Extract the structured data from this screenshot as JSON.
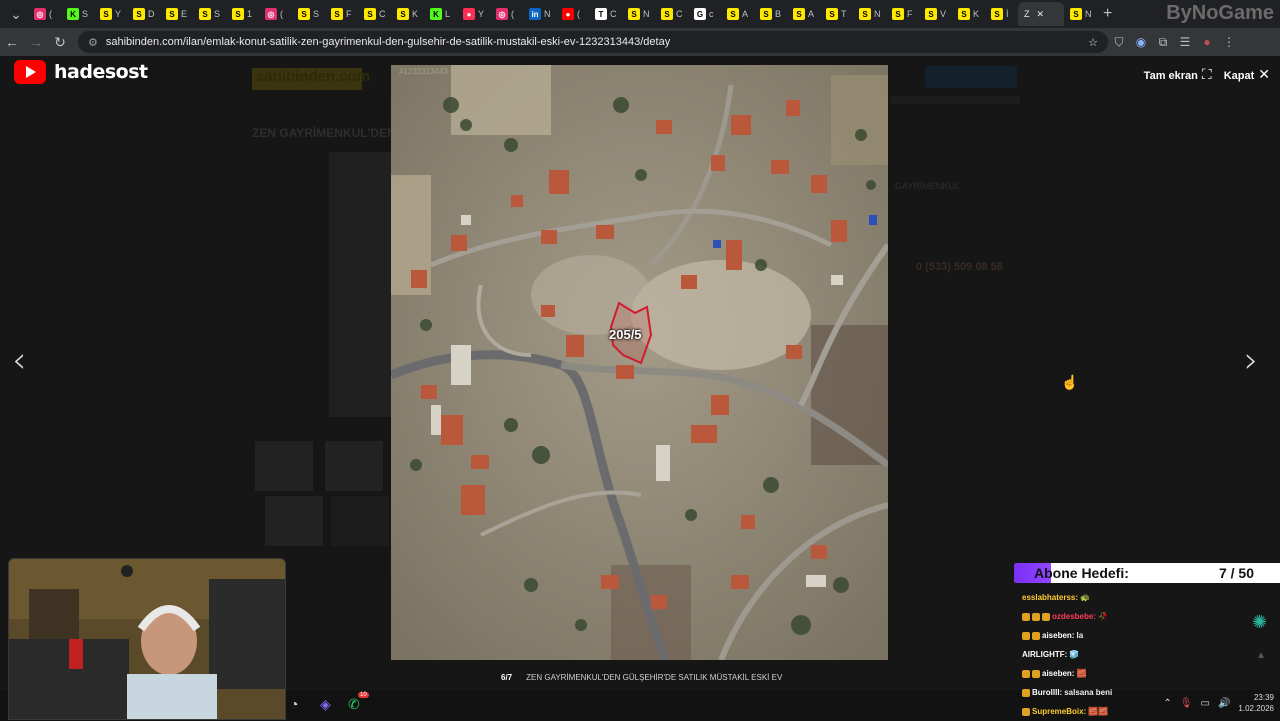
{
  "browser": {
    "tabs": [
      {
        "glyph": "◎",
        "color": "#e1306c",
        "text": "("
      },
      {
        "glyph": "K",
        "color": "#53fc18",
        "text": "S"
      },
      {
        "glyph": "S",
        "color": "#ffe800",
        "text": "Y"
      },
      {
        "glyph": "S",
        "color": "#ffe800",
        "text": "D"
      },
      {
        "glyph": "S",
        "color": "#ffe800",
        "text": "E"
      },
      {
        "glyph": "S",
        "color": "#ffe800",
        "text": "S"
      },
      {
        "glyph": "S",
        "color": "#ffe800",
        "text": "1"
      },
      {
        "glyph": "◎",
        "color": "#e1306c",
        "text": "("
      },
      {
        "glyph": "S",
        "color": "#ffe800",
        "text": "S"
      },
      {
        "glyph": "S",
        "color": "#ffe800",
        "text": "F"
      },
      {
        "glyph": "S",
        "color": "#ffe800",
        "text": "C"
      },
      {
        "glyph": "S",
        "color": "#ffe800",
        "text": "K"
      },
      {
        "glyph": "K",
        "color": "#53fc18",
        "text": "L"
      },
      {
        "glyph": "●",
        "color": "#ff2d55",
        "text": "Y"
      },
      {
        "glyph": "◎",
        "color": "#e1306c",
        "text": "("
      },
      {
        "glyph": "in",
        "color": "#0a66c2",
        "text": "N"
      },
      {
        "glyph": "●",
        "color": "#ff0000",
        "text": "("
      },
      {
        "glyph": "T",
        "color": "#ffffff",
        "text": "C"
      },
      {
        "glyph": "S",
        "color": "#ffe800",
        "text": "N"
      },
      {
        "glyph": "S",
        "color": "#ffe800",
        "text": "C"
      },
      {
        "glyph": "G",
        "color": "#ffffff",
        "text": "c"
      },
      {
        "glyph": "S",
        "color": "#ffe800",
        "text": "A"
      },
      {
        "glyph": "S",
        "color": "#ffe800",
        "text": "B"
      },
      {
        "glyph": "S",
        "color": "#ffe800",
        "text": "A"
      },
      {
        "glyph": "S",
        "color": "#ffe800",
        "text": "T"
      },
      {
        "glyph": "S",
        "color": "#ffe800",
        "text": "N"
      },
      {
        "glyph": "S",
        "color": "#ffe800",
        "text": "F"
      },
      {
        "glyph": "S",
        "color": "#ffe800",
        "text": "V"
      },
      {
        "glyph": "S",
        "color": "#ffe800",
        "text": "K"
      },
      {
        "glyph": "S",
        "color": "#ffe800",
        "text": "İ"
      }
    ],
    "active_tab": {
      "text": "Z",
      "close": "✕"
    },
    "extra_tab": {
      "glyph": "S",
      "text": "N"
    },
    "new_tab": "+",
    "brand_watermark": "ByNoGame",
    "url": "sahibinden.com/ilan/emlak-konut-satilik-zen-gayrimenkul-den-gulsehir-de-satilik-mustakil-eski-ev-1232313443/detay"
  },
  "background_page": {
    "logo": "sahibinden.com",
    "listing_no": "#1232313443",
    "title": "ZEN GAYRİMENKUL'DEN",
    "phone": "0 (533) 509 08 58",
    "agency": "GAYRİMENKUL"
  },
  "overlay": {
    "channel_name": "hadesost",
    "fullscreen_label": "Tam ekran",
    "close_label": "Kapat",
    "image_counter": "6/7",
    "image_caption": "ZEN GAYRİMENKUL'DEN GÜLŞEHİR'DE SATILIK MÜSTAKİL ESKİ EV",
    "map_parcel_label": "205/5"
  },
  "stream": {
    "goal_label": "Abone Hedefi:",
    "goal_count": "7 / 50",
    "goal_progress": 0.14,
    "chat": [
      {
        "user": "esslabhaterss:",
        "msg": "🐢",
        "color": "#ffcc33",
        "badges": 0
      },
      {
        "user": "ozdesbebe:",
        "msg": "🥀",
        "color": "#ff3b5c",
        "badges": 3
      },
      {
        "user": "aiseben:",
        "msg": "la",
        "color": "#ffffff",
        "badges": 2
      },
      {
        "user": "AIRLIGHTF:",
        "msg": "🧊",
        "color": "#ffffff",
        "badges": 0
      },
      {
        "user": "aiseben:",
        "msg": "🧱",
        "color": "#ffffff",
        "badges": 2
      },
      {
        "user": "Burollll:",
        "msg": "salsana beni",
        "color": "#ffffff",
        "badges": 1
      },
      {
        "user": "SupremeBoix:",
        "msg": "🧱🧱",
        "color": "#ffcc33",
        "badges": 1
      }
    ]
  },
  "taskbar": {
    "time": "23:39",
    "date": "1.02.2026",
    "notif_count": "10"
  }
}
